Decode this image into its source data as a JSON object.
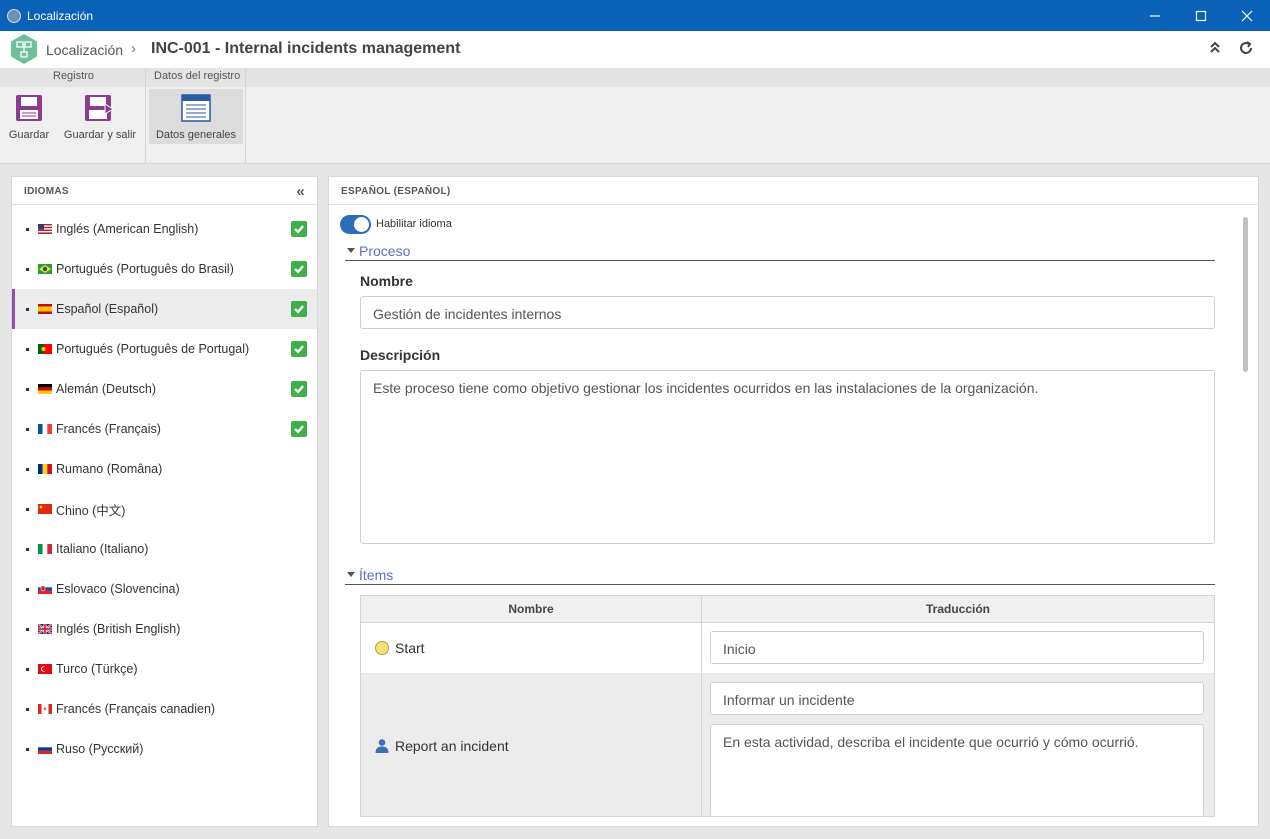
{
  "window": {
    "title": "Localización"
  },
  "header": {
    "breadcrumb": "Localización",
    "title": "INC-001 - Internal incidents management"
  },
  "ribbon": {
    "group_registro": "Registro",
    "group_datos": "Datos del registro",
    "save": "Guardar",
    "save_exit": "Guardar y salir",
    "general_data": "Datos generales"
  },
  "languages": {
    "heading": "IDIOMAS",
    "items": [
      {
        "label": "Inglés (American English)",
        "flag": "us",
        "done": true
      },
      {
        "label": "Portugués (Português do Brasil)",
        "flag": "br",
        "done": true
      },
      {
        "label": "Español (Español)",
        "flag": "es",
        "done": true,
        "active": true
      },
      {
        "label": "Portugués (Português de Portugal)",
        "flag": "pt",
        "done": true
      },
      {
        "label": "Alemán (Deutsch)",
        "flag": "de",
        "done": true
      },
      {
        "label": "Francés (Français)",
        "flag": "fr",
        "done": true
      },
      {
        "label": "Rumano (Româna)",
        "flag": "ro",
        "done": false
      },
      {
        "label": "Chino (中文)",
        "flag": "cn",
        "done": false
      },
      {
        "label": "Italiano (Italiano)",
        "flag": "it",
        "done": false
      },
      {
        "label": "Eslovaco (Slovencina)",
        "flag": "sk",
        "done": false
      },
      {
        "label": "Inglés (British English)",
        "flag": "gb",
        "done": false
      },
      {
        "label": "Turco (Türkçe)",
        "flag": "tr",
        "done": false
      },
      {
        "label": "Francés (Français canadien)",
        "flag": "ca",
        "done": false
      },
      {
        "label": "Ruso (Русский)",
        "flag": "ru",
        "done": false
      }
    ]
  },
  "detail": {
    "heading": "ESPAÑOL (ESPAÑOL)",
    "enable_label": "Habilitar idioma",
    "process_section": "Proceso",
    "name_label": "Nombre",
    "name_value": "Gestión de incidentes internos",
    "desc_label": "Descripción",
    "desc_value": "Este proceso tiene como objetivo gestionar los incidentes ocurridos en las instalaciones de la organización.",
    "items_section": "Ítems",
    "table": {
      "col_name": "Nombre",
      "col_translation": "Traducción",
      "rows": [
        {
          "name": "Start",
          "icon": "start-event-icon",
          "translation": "Inicio"
        },
        {
          "name": "Report an incident",
          "icon": "user-task-icon",
          "translation": "Informar un incidente",
          "description": "En esta actividad, describa el incidente que ocurrió y cómo ocurrió."
        }
      ]
    }
  },
  "colors": {
    "titlebar": "#0a62b8",
    "accent": "#8a4fb0",
    "check": "#3db04b",
    "toggle": "#2a6dbb",
    "section_link": "#5a6fbf"
  }
}
